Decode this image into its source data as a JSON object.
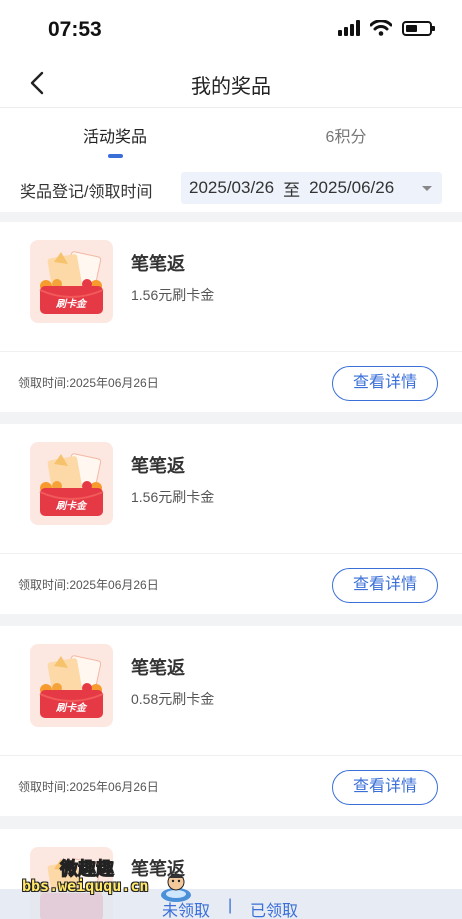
{
  "status_bar": {
    "time": "07:53"
  },
  "nav": {
    "title": "我的奖品"
  },
  "tabs": [
    {
      "label": "活动奖品",
      "active": true
    },
    {
      "label": "6积分",
      "active": false
    }
  ],
  "filter": {
    "label": "奖品登记/领取时间",
    "date_from": "2025/03/26",
    "date_separator": "至",
    "date_to": "2025/06/26"
  },
  "prizes": [
    {
      "title": "笔笔返",
      "amount": "1.56元刷卡金",
      "time": "领取时间:2025年06月26日",
      "button": "查看详情"
    },
    {
      "title": "笔笔返",
      "amount": "1.56元刷卡金",
      "time": "领取时间:2025年06月26日",
      "button": "查看详情"
    },
    {
      "title": "笔笔返",
      "amount": "0.58元刷卡金",
      "time": "领取时间:2025年06月26日",
      "button": "查看详情"
    },
    {
      "title": "笔笔返"
    }
  ],
  "thumb_badge": "刷卡金",
  "bottom_bar": {
    "unclaimed": "未领取",
    "divider": "|",
    "claimed": "已领取"
  },
  "watermark": {
    "text": "微趣趣",
    "url": "bbs.weiququ.cn"
  },
  "colors": {
    "accent": "#3a6fd8",
    "thumb_bg": "#fde7e1",
    "envelope": "#e63946"
  }
}
